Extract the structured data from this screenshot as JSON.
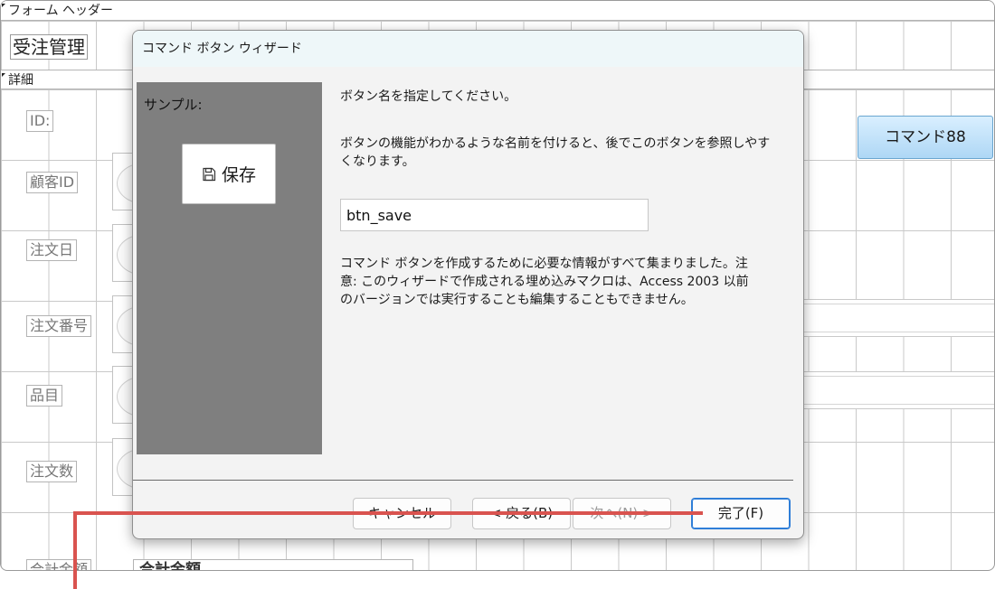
{
  "form": {
    "header_section": "フォーム ヘッダー",
    "detail_section": "詳細",
    "title": "受注管理",
    "fields": [
      {
        "label": "ID:"
      },
      {
        "label": "顧客ID"
      },
      {
        "label": "注文日"
      },
      {
        "label": "注文番号"
      },
      {
        "label": "品目"
      },
      {
        "label": "注文数"
      }
    ],
    "command_button": "コマンド88",
    "footer_label": "合計金額",
    "footer_text": "合計金額"
  },
  "dialog": {
    "title": "コマンド ボタン ウィザード",
    "sample_label": "サンプル:",
    "sample_button": {
      "icon": "floppy-disk-icon",
      "text": "保存"
    },
    "instruction_1": "ボタン名を指定してください。",
    "instruction_2": "ボタンの機能がわかるような名前を付けると、後でこのボタンを参照しやすくなります。",
    "button_name_value": "btn_save",
    "instruction_3": "コマンド ボタンを作成するために必要な情報がすべて集まりました。注意: このウィザードで作成される埋め込みマクロは、Access 2003 以前のバージョンでは実行することも編集することもできません。",
    "buttons": {
      "cancel": "キャンセル",
      "back": "< 戻る(B)",
      "next": "次へ(N) >",
      "finish": "完了(F)"
    }
  },
  "colors": {
    "callout": "#d9534f",
    "finish_focus": "#2f7ed8"
  }
}
